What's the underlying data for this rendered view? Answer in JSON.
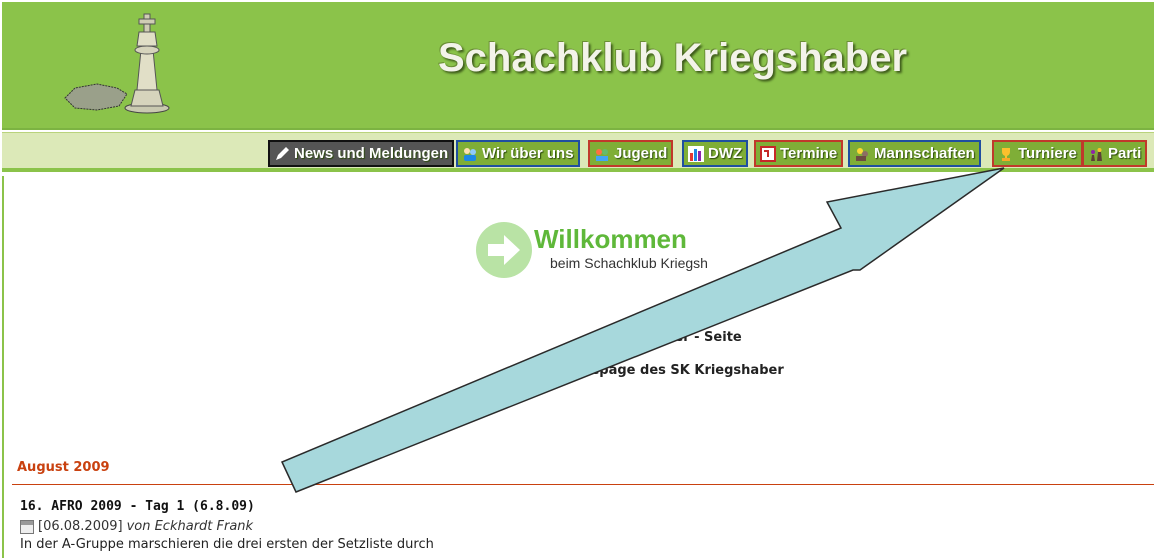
{
  "header": {
    "title": "Schachklub Kriegshaber"
  },
  "nav": {
    "items": [
      {
        "label": "News und Meldungen",
        "icon": "pencil-icon"
      },
      {
        "label": "Wir über uns",
        "icon": "people-icon"
      },
      {
        "label": "Jugend",
        "icon": "youth-icon"
      },
      {
        "label": "DWZ",
        "icon": "bar-chart-icon"
      },
      {
        "label": "Termine",
        "icon": "calendar-icon"
      },
      {
        "label": "Mannschaften",
        "icon": "team-icon"
      },
      {
        "label": "Turniere",
        "icon": "trophy-icon"
      },
      {
        "label": "Parti",
        "icon": "chess-pieces-icon"
      }
    ]
  },
  "welcome": {
    "title": "Willkommen",
    "subtitle": "beim Schachklub Kriegsh"
  },
  "content": {
    "line1": "urnier - Seite",
    "line2": "omepage des SK Kriegshaber"
  },
  "news": {
    "month": "August 2009",
    "title": "16. AFRO 2009 - Tag 1 (6.8.09)",
    "date": "[06.08.2009]",
    "author": "von Eckhardt Frank",
    "text": "In der A-Gruppe marschieren die drei ersten der Setzliste durch"
  },
  "colors": {
    "header_green": "#8bc34a",
    "nav_bg": "#dce9b8",
    "accent_orange": "#c9410f",
    "welcome_green": "#5fb83a",
    "arrow_fill": "#a7d8dc"
  }
}
